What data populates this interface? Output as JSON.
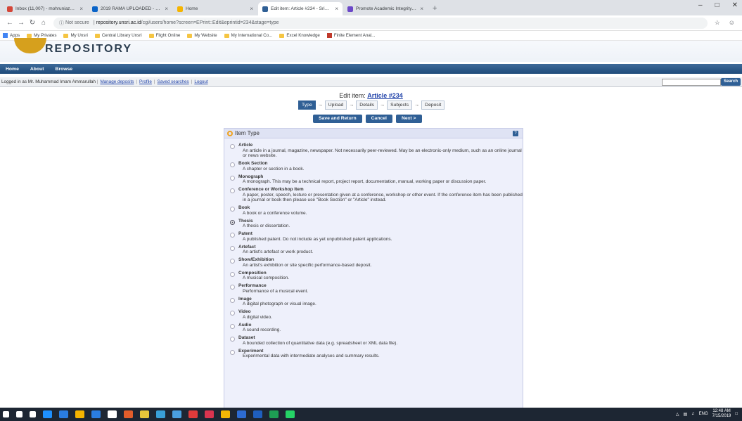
{
  "browser": {
    "tabs": [
      {
        "title": "Inbox (11,007) - mohruniaz@uns",
        "color": "#d44638"
      },
      {
        "title": "2019 RAMA UPLOADED - OneDr",
        "color": "#0a64c8"
      },
      {
        "title": "Home",
        "color": "#f5b400"
      },
      {
        "title": "Edit item: Article #234 - Sriwijaya",
        "color": "#2f5f95"
      },
      {
        "title": "Promote Academic Integrity | Ith",
        "color": "#6b48c8"
      }
    ],
    "url_status": "Not secure",
    "url_domain": "repository.unsri.ac.id",
    "url_path": "/cgi/users/home?screen=EPrint::Edit&eprintid=234&stage=type",
    "bookmarks": [
      "Apps",
      "My Privates",
      "My Unsri",
      "Central Library Unsri",
      "Flight Online",
      "My Website",
      "My International Co...",
      "Excel Knowledge",
      "Finite Element Anal..."
    ]
  },
  "site": {
    "logo_text": "REPOSITORY",
    "menu": [
      "Home",
      "About",
      "Browse"
    ],
    "logged_in": "Logged in as Mr. Muhammad Imam Ammarullah",
    "user_links": [
      "Manage deposits",
      "Profile",
      "Saved searches",
      "Logout"
    ],
    "search_button": "Search"
  },
  "edit": {
    "title_prefix": "Edit item: ",
    "title_link": "Article #234",
    "stages": [
      "Type",
      "Upload",
      "Details",
      "Subjects",
      "Deposit"
    ],
    "current_stage": "Type",
    "buttons": [
      "Save and Return",
      "Cancel",
      "Next >"
    ],
    "panel_title": "Item Type",
    "options": [
      {
        "title": "Article",
        "desc": "An article in a journal, magazine, newspaper. Not necessarily peer-reviewed. May be an electronic-only medium, such as an online journal or news website.",
        "selected": false
      },
      {
        "title": "Book Section",
        "desc": "A chapter or section in a book.",
        "selected": false
      },
      {
        "title": "Monograph",
        "desc": "A monograph. This may be a technical report, project report, documentation, manual, working paper or discussion paper.",
        "selected": false
      },
      {
        "title": "Conference or Workshop Item",
        "desc": "A paper, poster, speech, lecture or presentation given at a conference, workshop or other event. If the conference item has been published in a journal or book then please use \"Book Section\" or \"Article\" instead.",
        "selected": false
      },
      {
        "title": "Book",
        "desc": "A book or a conference volume.",
        "selected": false
      },
      {
        "title": "Thesis",
        "desc": "A thesis or dissertation.",
        "selected": true
      },
      {
        "title": "Patent",
        "desc": "A published patent. Do not include as yet unpublished patent applications.",
        "selected": false
      },
      {
        "title": "Artefact",
        "desc": "An artist's artefact or work product.",
        "selected": false
      },
      {
        "title": "Show/Exhibition",
        "desc": "An artist's exhibition or site specific performance-based deposit.",
        "selected": false
      },
      {
        "title": "Composition",
        "desc": "A musical composition.",
        "selected": false
      },
      {
        "title": "Performance",
        "desc": "Performance of a musical event.",
        "selected": false
      },
      {
        "title": "Image",
        "desc": "A digital photograph or visual image.",
        "selected": false
      },
      {
        "title": "Video",
        "desc": "A digital video.",
        "selected": false
      },
      {
        "title": "Audio",
        "desc": "A sound recording.",
        "selected": false
      },
      {
        "title": "Dataset",
        "desc": "A bounded collection of quantitative data (e.g. spreadsheet or XML data file).",
        "selected": false
      },
      {
        "title": "Experiment",
        "desc": "Experimental data with intermediate analyses and summary results.",
        "selected": false
      }
    ]
  },
  "taskbar": {
    "lang": "ENG",
    "time": "12:48 AM",
    "date": "7/15/2019",
    "icon_colors": [
      "#ffffff",
      "#ffffff",
      "#ffffff",
      "#1e90ff",
      "#2a7de1",
      "#f5b400",
      "#2a7de1",
      "#ffffff",
      "#e25d2b",
      "#e8c53a",
      "#39a0d8",
      "#4aa0e0",
      "#e03b3b",
      "#d9344f",
      "#f2b705",
      "#2d6bd1",
      "#1f5fbf",
      "#1e9e54",
      "#25d366"
    ]
  }
}
